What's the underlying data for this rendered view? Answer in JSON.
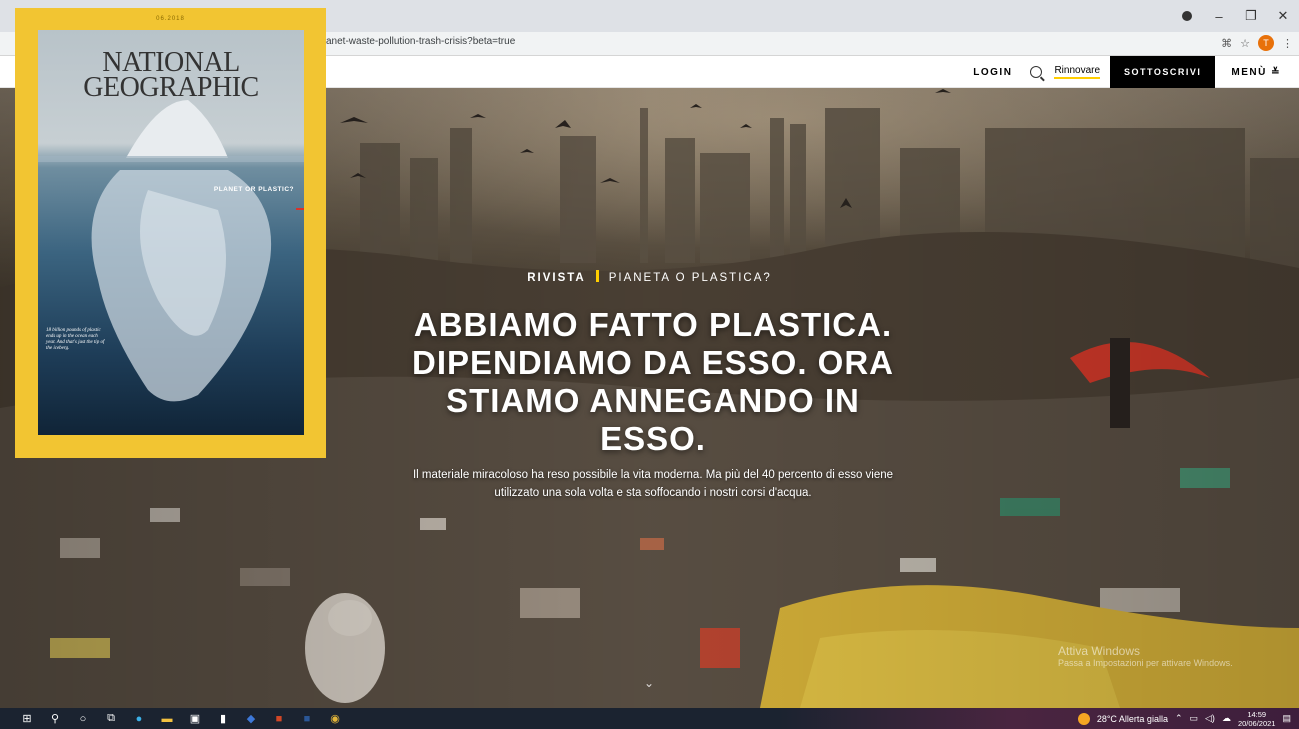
{
  "browser": {
    "url": "anet-waste-pollution-trash-crisis?beta=true",
    "profile_initial": "T",
    "controls": {
      "minimize": "–",
      "restore": "❐",
      "close": "✕"
    },
    "icons": [
      "translate-icon",
      "star-icon",
      "profile-icon",
      "more-icon"
    ]
  },
  "header": {
    "login": "LOGIN",
    "renew": "Rinnovare",
    "subscribe": "SOTTOSCRIVI",
    "menu": "MENÙ"
  },
  "hero": {
    "kicker_section": "RIVISTA",
    "kicker_topic": "PIANETA O PLASTICA?",
    "headline": "ABBIAMO FATTO PLASTICA. DIPENDIAMO DA ESSO. ORA STIAMO ANNEGANDO IN ESSO.",
    "dek": "Il materiale miracoloso ha reso possibile la vita moderna. Ma più del 40 percento di esso viene utilizzato una sola volta e sta soffocando i nostri corsi d'acqua.",
    "scroll_cue": "⌄"
  },
  "cover": {
    "date": "06.2018",
    "masthead_line1": "NATIONAL",
    "masthead_line2": "GEOGRAPHIC",
    "tagline": "PLANET OR PLASTIC?",
    "note": "18 billion pounds of plastic ends up in the ocean each year. And that's just the tip of the iceberg."
  },
  "watermark": {
    "line1": "Attiva Windows",
    "line2": "Passa a Impostazioni per attivare Windows."
  },
  "taskbar": {
    "apps": [
      "windows-start-icon",
      "search-icon",
      "cortana-icon",
      "task-view-icon",
      "edge-icon",
      "file-explorer-icon",
      "store-icon",
      "usb-icon",
      "teams-icon",
      "powerpoint-icon",
      "word-icon",
      "chrome-icon"
    ],
    "weather": "28°C  Allerta gialla",
    "time": "14:59",
    "date": "20/06/2021"
  },
  "colors": {
    "accent_yellow": "#ffce00",
    "cover_yellow": "#f2c532",
    "subscribe_bg": "#000000"
  }
}
